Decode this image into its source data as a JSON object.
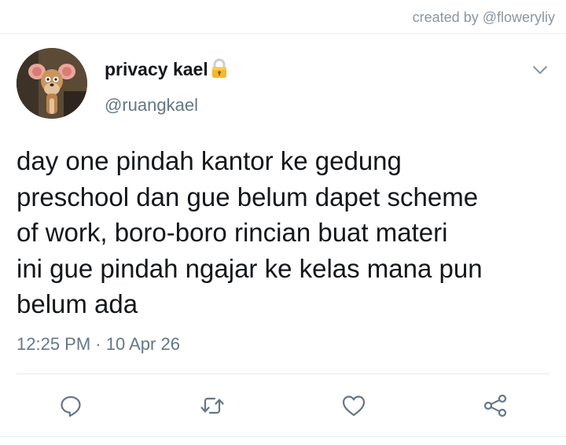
{
  "credit": "created by @floweryliy",
  "tweet": {
    "display_name": "privacy kael",
    "handle": "@ruangkael",
    "text": "day one pindah kantor ke gedung\npreschool dan gue belum dapet scheme\nof work, boro-boro rincian buat materi\nini gue pindah ngajar ke kelas mana pun\nbelum ada",
    "time": "12:25 PM",
    "separator": "·",
    "date": "10 Apr 26"
  },
  "icons": {
    "lock": "lock-icon",
    "menu": "chevron-down-icon",
    "reply": "reply-icon",
    "retweet": "retweet-icon",
    "like": "heart-icon",
    "share": "share-icon"
  },
  "colors": {
    "icon": "#657786",
    "secondary_text": "#657786",
    "divider": "#e6ecf0"
  }
}
